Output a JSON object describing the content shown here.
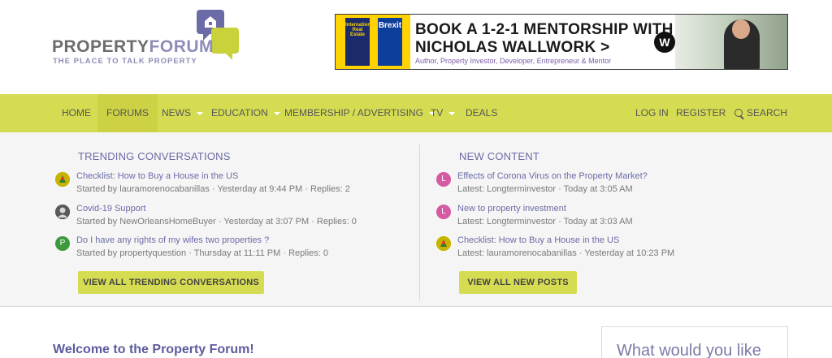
{
  "logo": {
    "word1": "PROPERTY",
    "word2": "FORUM",
    "tagline": "THE PLACE TO TALK PROPERTY"
  },
  "banner": {
    "line1": "BOOK A 1-2-1 MENTORSHIP WITH",
    "line2": "NICHOLAS WALLWORK >",
    "line3": "Author, Property Investor, Developer, Entrepreneur & Mentor",
    "w_logo": "W",
    "book1_text": "International Real Estate",
    "book2_text": "Brexit"
  },
  "nav": {
    "home": "HOME",
    "forums": "FORUMS",
    "news": "NEWS",
    "education": "EDUCATION",
    "membership": "MEMBERSHIP / ADVERTISING",
    "tv": "TV",
    "deals": "DEALS",
    "login": "LOG IN",
    "register": "REGISTER",
    "search": "SEARCH"
  },
  "trending": {
    "title": "TRENDING CONVERSATIONS",
    "items": [
      {
        "title": "Checklist: How to Buy a House in the US",
        "meta": "Started by lauramorenocabanillas · Yesterday at 9:44 PM · Replies: 2",
        "avatar": "",
        "avatar_color": "#c8b400"
      },
      {
        "title": "Covid-19 Support",
        "meta": "Started by NewOrleansHomeBuyer · Yesterday at 3:07 PM · Replies: 0",
        "avatar": "",
        "avatar_color": "#4a4a4a"
      },
      {
        "title": "Do I have any rights of my wifes two properties ?",
        "meta": "Started by propertyquestion · Thursday at 11:11 PM · Replies: 0",
        "avatar": "P",
        "avatar_color": "#3c9a3c"
      }
    ],
    "button": "VIEW ALL TRENDING CONVERSATIONS"
  },
  "new_content": {
    "title": "NEW CONTENT",
    "items": [
      {
        "title": "Effects of Corona Virus on the Property Market?",
        "meta": "Latest: Longterminvestor · Today at 3:05 AM",
        "avatar": "L",
        "avatar_color": "#d45ba2"
      },
      {
        "title": "New to property investment",
        "meta": "Latest: Longterminvestor · Today at 3:03 AM",
        "avatar": "L",
        "avatar_color": "#d45ba2"
      },
      {
        "title": "Checklist: How to Buy a House in the US",
        "meta": "Latest: lauramorenocabanillas · Yesterday at 10:23 PM",
        "avatar": "",
        "avatar_color": "#c8b400"
      }
    ],
    "button": "VIEW ALL NEW POSTS"
  },
  "welcome": "Welcome to the Property Forum!",
  "side_box": "What would you like",
  "colors": {
    "nav_bg": "#d6dc51",
    "accent_text": "#6b6ba8"
  }
}
